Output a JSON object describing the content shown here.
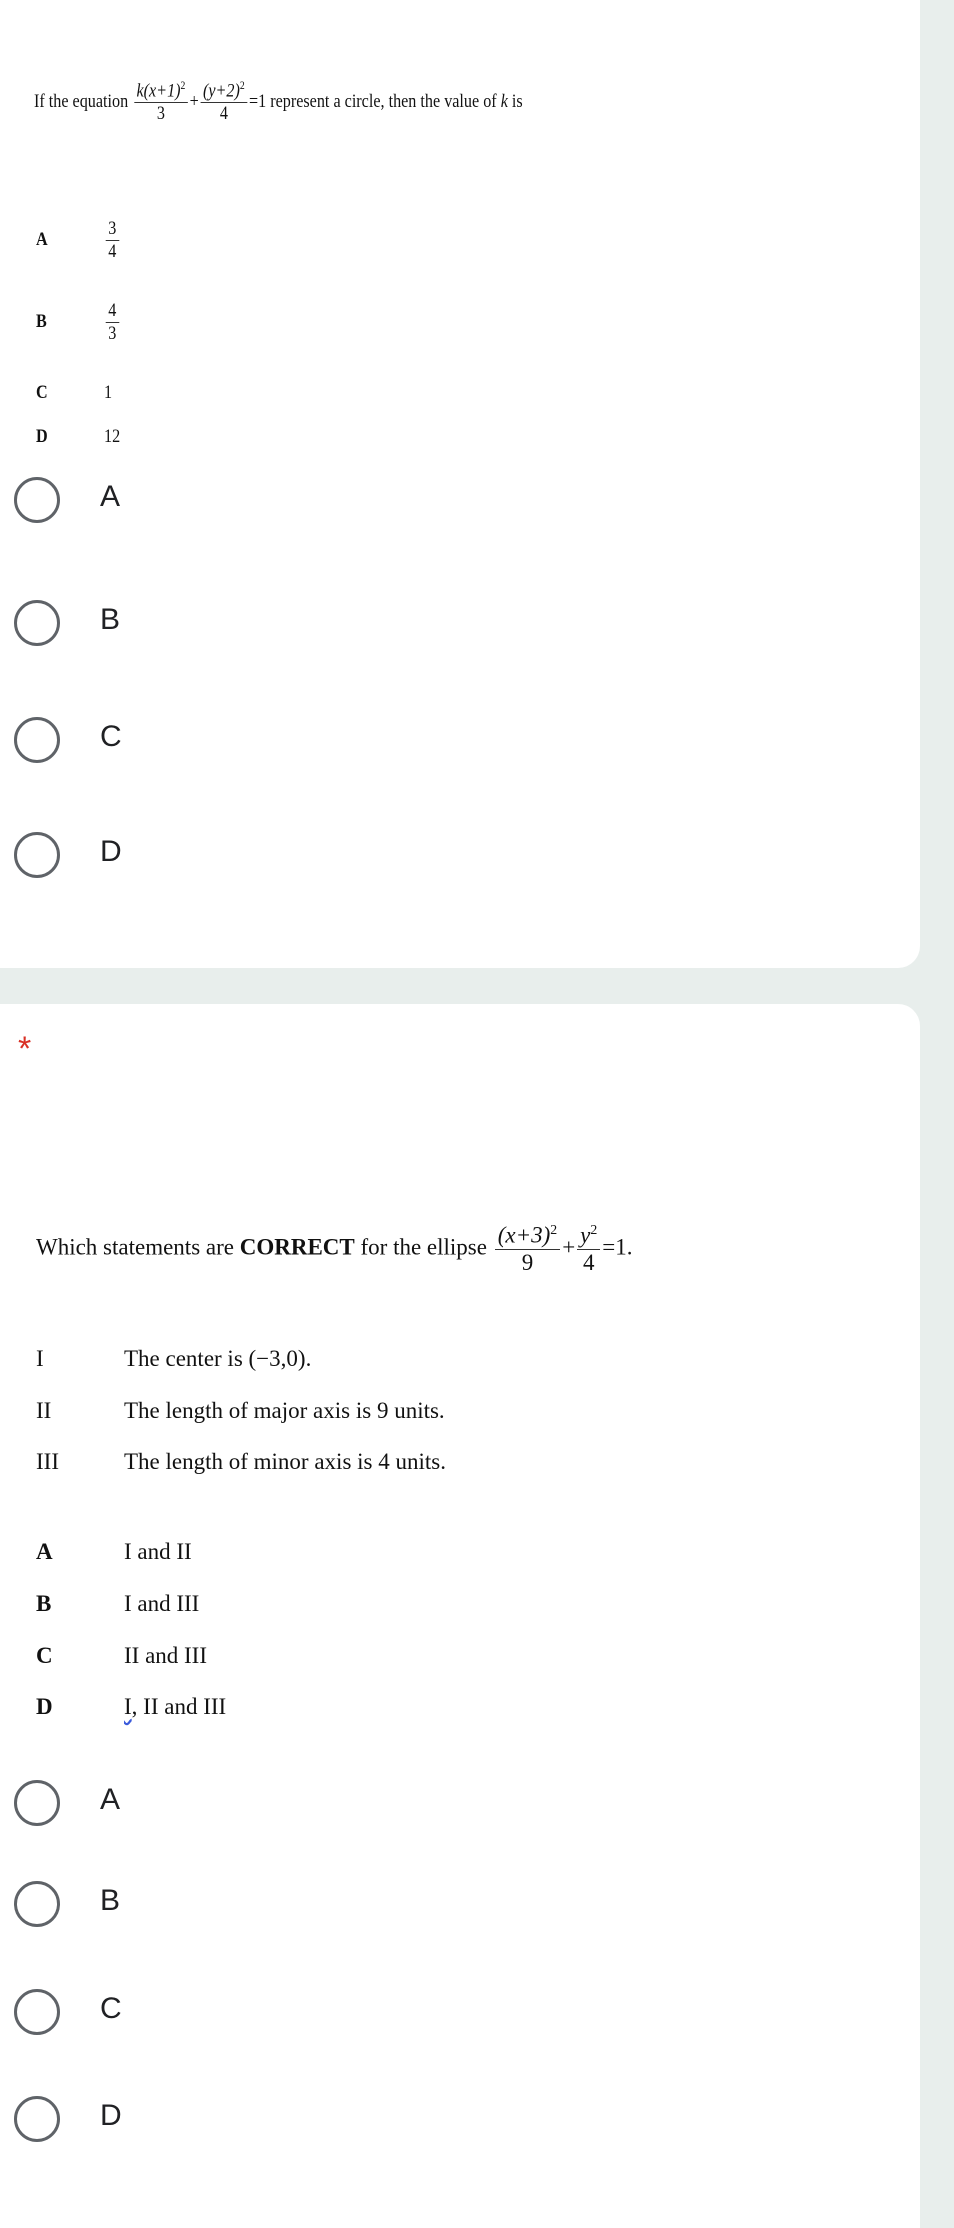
{
  "q1": {
    "prefix": "If the equation",
    "f1_num": "k(x+1)",
    "f1_den": "3",
    "plus": "+",
    "f2_num": "(y+2)",
    "f2_den": "4",
    "sq": "2",
    "eq": "=1",
    "suffix": "represent a circle, then the value of",
    "k": "k",
    "is": "is",
    "options": [
      {
        "letter": "A",
        "num": "3",
        "den": "4"
      },
      {
        "letter": "B",
        "num": "4",
        "den": "3"
      },
      {
        "letter": "C",
        "value": "1"
      },
      {
        "letter": "D",
        "value": "12"
      }
    ],
    "radios": [
      "A",
      "B",
      "C",
      "D"
    ]
  },
  "q2": {
    "required": "*",
    "prefix": "Which statements are",
    "bold": "CORRECT",
    "mid": "for the ellipse",
    "f1_num": "(x+3)",
    "f1_den": "9",
    "sq": "2",
    "plus": "+",
    "f2_num": "y",
    "f2_den": "4",
    "eq": "=1.",
    "statements": [
      {
        "roman": "I",
        "text": "The center is (−3,0)."
      },
      {
        "roman": "II",
        "text": "The length of major axis is 9 units."
      },
      {
        "roman": "III",
        "text": "The length of minor axis is 4 units."
      }
    ],
    "options": [
      {
        "letter": "A",
        "text": "I and II"
      },
      {
        "letter": "B",
        "text": "I and III"
      },
      {
        "letter": "C",
        "text": "II and III"
      },
      {
        "letter": "D",
        "text_a": "I",
        "text_b": ", II and III"
      }
    ],
    "radios": [
      "A",
      "B",
      "C",
      "D"
    ]
  },
  "colors": {
    "background": "#e8eeec",
    "required": "#d93025",
    "radio_border": "#5f6368"
  }
}
